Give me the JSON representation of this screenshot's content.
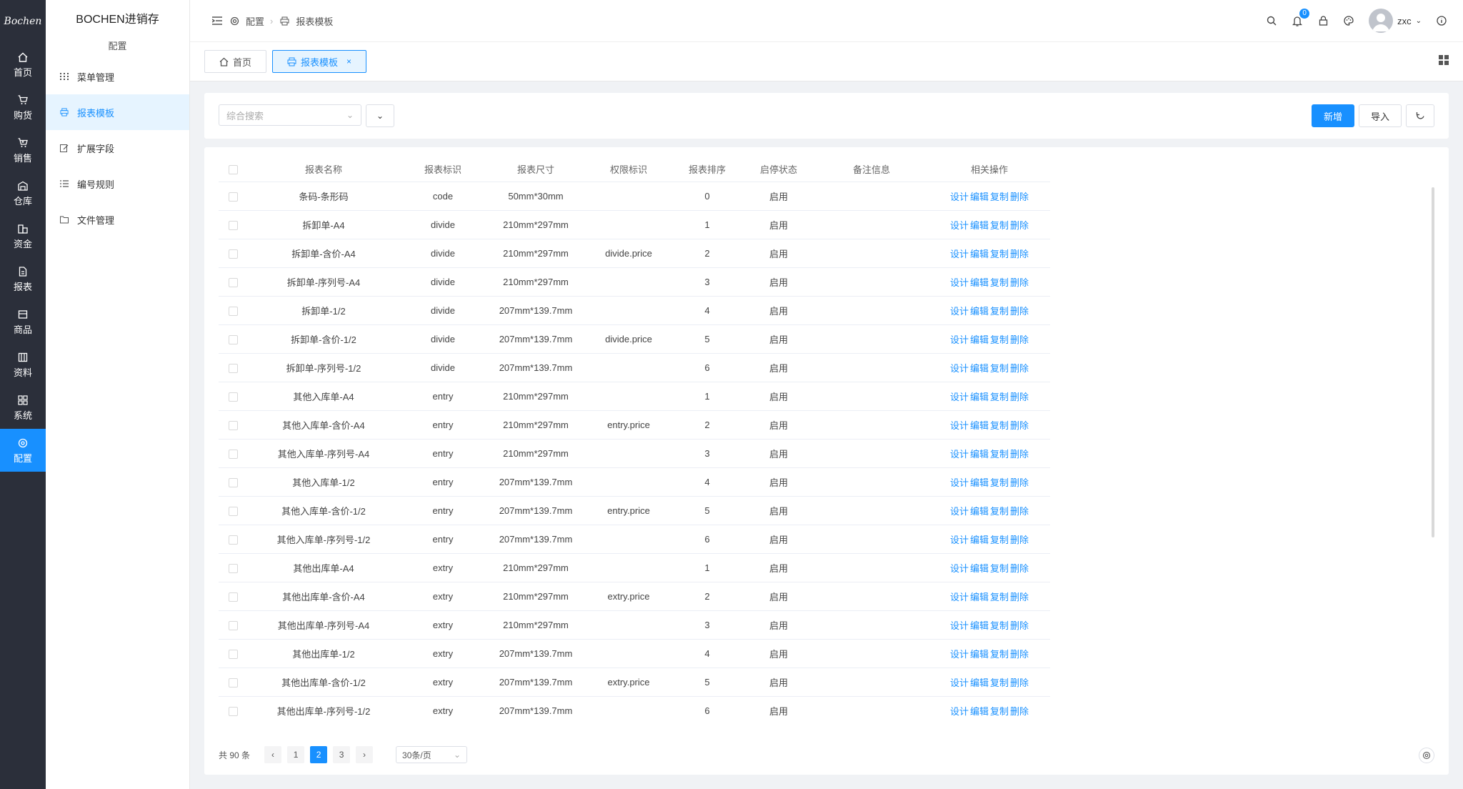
{
  "logo": "Bochen",
  "rail": [
    {
      "label": "首页",
      "icon": "home-icon"
    },
    {
      "label": "购货",
      "icon": "cart-icon"
    },
    {
      "label": "销售",
      "icon": "sales-cart-icon"
    },
    {
      "label": "仓库",
      "icon": "warehouse-icon"
    },
    {
      "label": "资金",
      "icon": "finance-icon"
    },
    {
      "label": "报表",
      "icon": "report-icon"
    },
    {
      "label": "商品",
      "icon": "product-icon"
    },
    {
      "label": "资料",
      "icon": "data-icon"
    },
    {
      "label": "系统",
      "icon": "system-icon"
    },
    {
      "label": "配置",
      "icon": "config-icon",
      "active": true
    }
  ],
  "submenu": {
    "brand": "BOCHEN进销存",
    "title": "配置",
    "items": [
      {
        "label": "菜单管理",
        "icon": "menu-grid-icon"
      },
      {
        "label": "报表模板",
        "icon": "printer-icon",
        "active": true
      },
      {
        "label": "扩展字段",
        "icon": "edit-field-icon"
      },
      {
        "label": "编号规则",
        "icon": "list-icon"
      },
      {
        "label": "文件管理",
        "icon": "folder-icon"
      }
    ]
  },
  "header": {
    "breadcrumb": [
      "配置",
      "报表模板"
    ],
    "notification_count": "0",
    "username": "zxc"
  },
  "tabs": [
    {
      "label": "首页",
      "icon": "home-icon"
    },
    {
      "label": "报表模板",
      "icon": "printer-icon",
      "active": true,
      "closable": true
    }
  ],
  "search": {
    "placeholder": "综合搜索",
    "add_label": "新增",
    "import_label": "导入"
  },
  "table": {
    "columns": [
      "报表名称",
      "报表标识",
      "报表尺寸",
      "权限标识",
      "报表排序",
      "启停状态",
      "备注信息",
      "相关操作"
    ],
    "actions": [
      "设计",
      "编辑",
      "复制",
      "删除"
    ],
    "rows": [
      {
        "name": "条码-条形码",
        "key": "code",
        "size": "50mm*30mm",
        "perm": "",
        "sort": "0",
        "status": "启用",
        "remark": ""
      },
      {
        "name": "拆卸单-A4",
        "key": "divide",
        "size": "210mm*297mm",
        "perm": "",
        "sort": "1",
        "status": "启用",
        "remark": ""
      },
      {
        "name": "拆卸单-含价-A4",
        "key": "divide",
        "size": "210mm*297mm",
        "perm": "divide.price",
        "sort": "2",
        "status": "启用",
        "remark": ""
      },
      {
        "name": "拆卸单-序列号-A4",
        "key": "divide",
        "size": "210mm*297mm",
        "perm": "",
        "sort": "3",
        "status": "启用",
        "remark": ""
      },
      {
        "name": "拆卸单-1/2",
        "key": "divide",
        "size": "207mm*139.7mm",
        "perm": "",
        "sort": "4",
        "status": "启用",
        "remark": ""
      },
      {
        "name": "拆卸单-含价-1/2",
        "key": "divide",
        "size": "207mm*139.7mm",
        "perm": "divide.price",
        "sort": "5",
        "status": "启用",
        "remark": ""
      },
      {
        "name": "拆卸单-序列号-1/2",
        "key": "divide",
        "size": "207mm*139.7mm",
        "perm": "",
        "sort": "6",
        "status": "启用",
        "remark": ""
      },
      {
        "name": "其他入库单-A4",
        "key": "entry",
        "size": "210mm*297mm",
        "perm": "",
        "sort": "1",
        "status": "启用",
        "remark": ""
      },
      {
        "name": "其他入库单-含价-A4",
        "key": "entry",
        "size": "210mm*297mm",
        "perm": "entry.price",
        "sort": "2",
        "status": "启用",
        "remark": ""
      },
      {
        "name": "其他入库单-序列号-A4",
        "key": "entry",
        "size": "210mm*297mm",
        "perm": "",
        "sort": "3",
        "status": "启用",
        "remark": ""
      },
      {
        "name": "其他入库单-1/2",
        "key": "entry",
        "size": "207mm*139.7mm",
        "perm": "",
        "sort": "4",
        "status": "启用",
        "remark": ""
      },
      {
        "name": "其他入库单-含价-1/2",
        "key": "entry",
        "size": "207mm*139.7mm",
        "perm": "entry.price",
        "sort": "5",
        "status": "启用",
        "remark": ""
      },
      {
        "name": "其他入库单-序列号-1/2",
        "key": "entry",
        "size": "207mm*139.7mm",
        "perm": "",
        "sort": "6",
        "status": "启用",
        "remark": ""
      },
      {
        "name": "其他出库单-A4",
        "key": "extry",
        "size": "210mm*297mm",
        "perm": "",
        "sort": "1",
        "status": "启用",
        "remark": ""
      },
      {
        "name": "其他出库单-含价-A4",
        "key": "extry",
        "size": "210mm*297mm",
        "perm": "extry.price",
        "sort": "2",
        "status": "启用",
        "remark": ""
      },
      {
        "name": "其他出库单-序列号-A4",
        "key": "extry",
        "size": "210mm*297mm",
        "perm": "",
        "sort": "3",
        "status": "启用",
        "remark": ""
      },
      {
        "name": "其他出库单-1/2",
        "key": "extry",
        "size": "207mm*139.7mm",
        "perm": "",
        "sort": "4",
        "status": "启用",
        "remark": ""
      },
      {
        "name": "其他出库单-含价-1/2",
        "key": "extry",
        "size": "207mm*139.7mm",
        "perm": "extry.price",
        "sort": "5",
        "status": "启用",
        "remark": ""
      },
      {
        "name": "其他出库单-序列号-1/2",
        "key": "extry",
        "size": "207mm*139.7mm",
        "perm": "",
        "sort": "6",
        "status": "启用",
        "remark": ""
      }
    ]
  },
  "pagination": {
    "total": "共 90 条",
    "pages": [
      "1",
      "2",
      "3"
    ],
    "current_page": 2,
    "page_size": "30条/页"
  },
  "colors": {
    "primary": "#1890ff",
    "rail_bg": "#2b2f3a",
    "page_bg": "#f0f2f5"
  }
}
